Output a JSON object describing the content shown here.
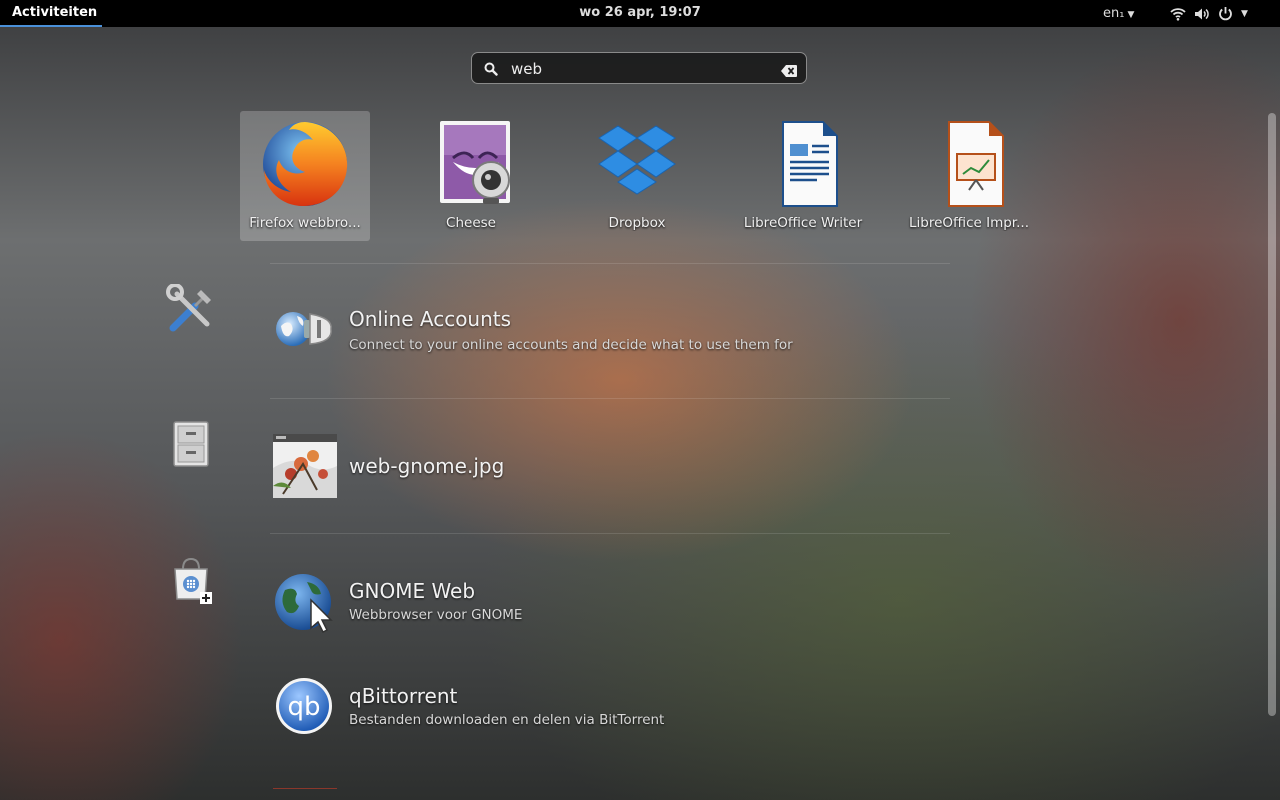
{
  "topbar": {
    "activities_label": "Activiteiten",
    "clock": "wo 26 apr, 19:07",
    "keyboard_layout": "en₁",
    "icons": [
      "wifi-icon",
      "volume-icon",
      "power-icon",
      "system-menu-arrow-icon"
    ]
  },
  "search": {
    "value": "web",
    "icons": [
      "search-icon",
      "clear-icon"
    ]
  },
  "apps": [
    {
      "label": "Firefox webbro...",
      "icon": "firefox-icon",
      "selected": true
    },
    {
      "label": "Cheese",
      "icon": "cheese-icon",
      "selected": false
    },
    {
      "label": "Dropbox",
      "icon": "dropbox-icon",
      "selected": false
    },
    {
      "label": "LibreOffice Writer",
      "icon": "libreoffice-writer-icon",
      "selected": false
    },
    {
      "label": "LibreOffice Impr...",
      "icon": "libreoffice-impress-icon",
      "selected": false
    }
  ],
  "providers": [
    {
      "icon": "settings-tools-icon",
      "results": [
        {
          "title": "Online Accounts",
          "description": "Connect to your online accounts and decide what to use them for",
          "icon": "online-accounts-icon"
        }
      ]
    },
    {
      "icon": "files-cabinet-icon",
      "results": [
        {
          "title": "web-gnome.jpg",
          "description": "",
          "icon": "image-thumbnail-icon"
        }
      ]
    },
    {
      "icon": "software-store-icon",
      "results": [
        {
          "title": "GNOME Web",
          "description": "Webbrowser voor GNOME",
          "icon": "gnome-web-icon"
        },
        {
          "title": "qBittorrent",
          "description": "Bestanden downloaden en delen via BitTorrent",
          "icon": "qbittorrent-icon"
        }
      ]
    }
  ],
  "colors": {
    "topbar_bg": "#000000",
    "activities_underline": "#4a90d9",
    "selection": "#ffffff38"
  }
}
